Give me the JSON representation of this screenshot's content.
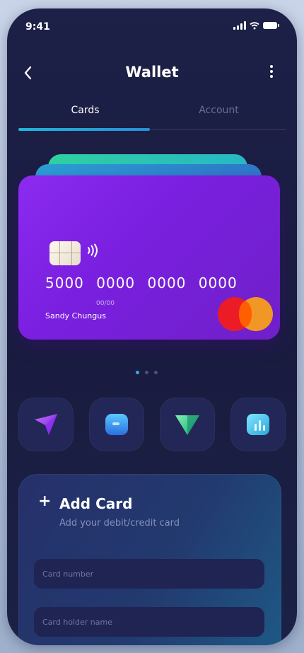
{
  "status_bar": {
    "time": "9:41"
  },
  "header": {
    "title": "Wallet"
  },
  "tabs": [
    {
      "label": "Cards",
      "active": true
    },
    {
      "label": "Account",
      "active": false
    }
  ],
  "card": {
    "number": "5000 0000 0000 0000",
    "valid_thru": "00/00",
    "holder": "Sandy Chungus",
    "network": "mastercard",
    "colors": {
      "gradient_start": "#8b2bf0",
      "gradient_end": "#6f20c8"
    }
  },
  "pagination": {
    "count": 3,
    "active_index": 0
  },
  "quick_actions": [
    {
      "icon": "send-icon"
    },
    {
      "icon": "wallet-icon"
    },
    {
      "icon": "receive-icon"
    },
    {
      "icon": "chart-icon"
    }
  ],
  "add_card": {
    "title": "Add Card",
    "subtitle": "Add your debit/credit card",
    "card_number_placeholder": "Card number",
    "card_holder_placeholder": "Card holder name"
  },
  "colors": {
    "background": "#1d2047",
    "accent": "#1fb6d9",
    "tab_inactive": "#6a6f96"
  }
}
